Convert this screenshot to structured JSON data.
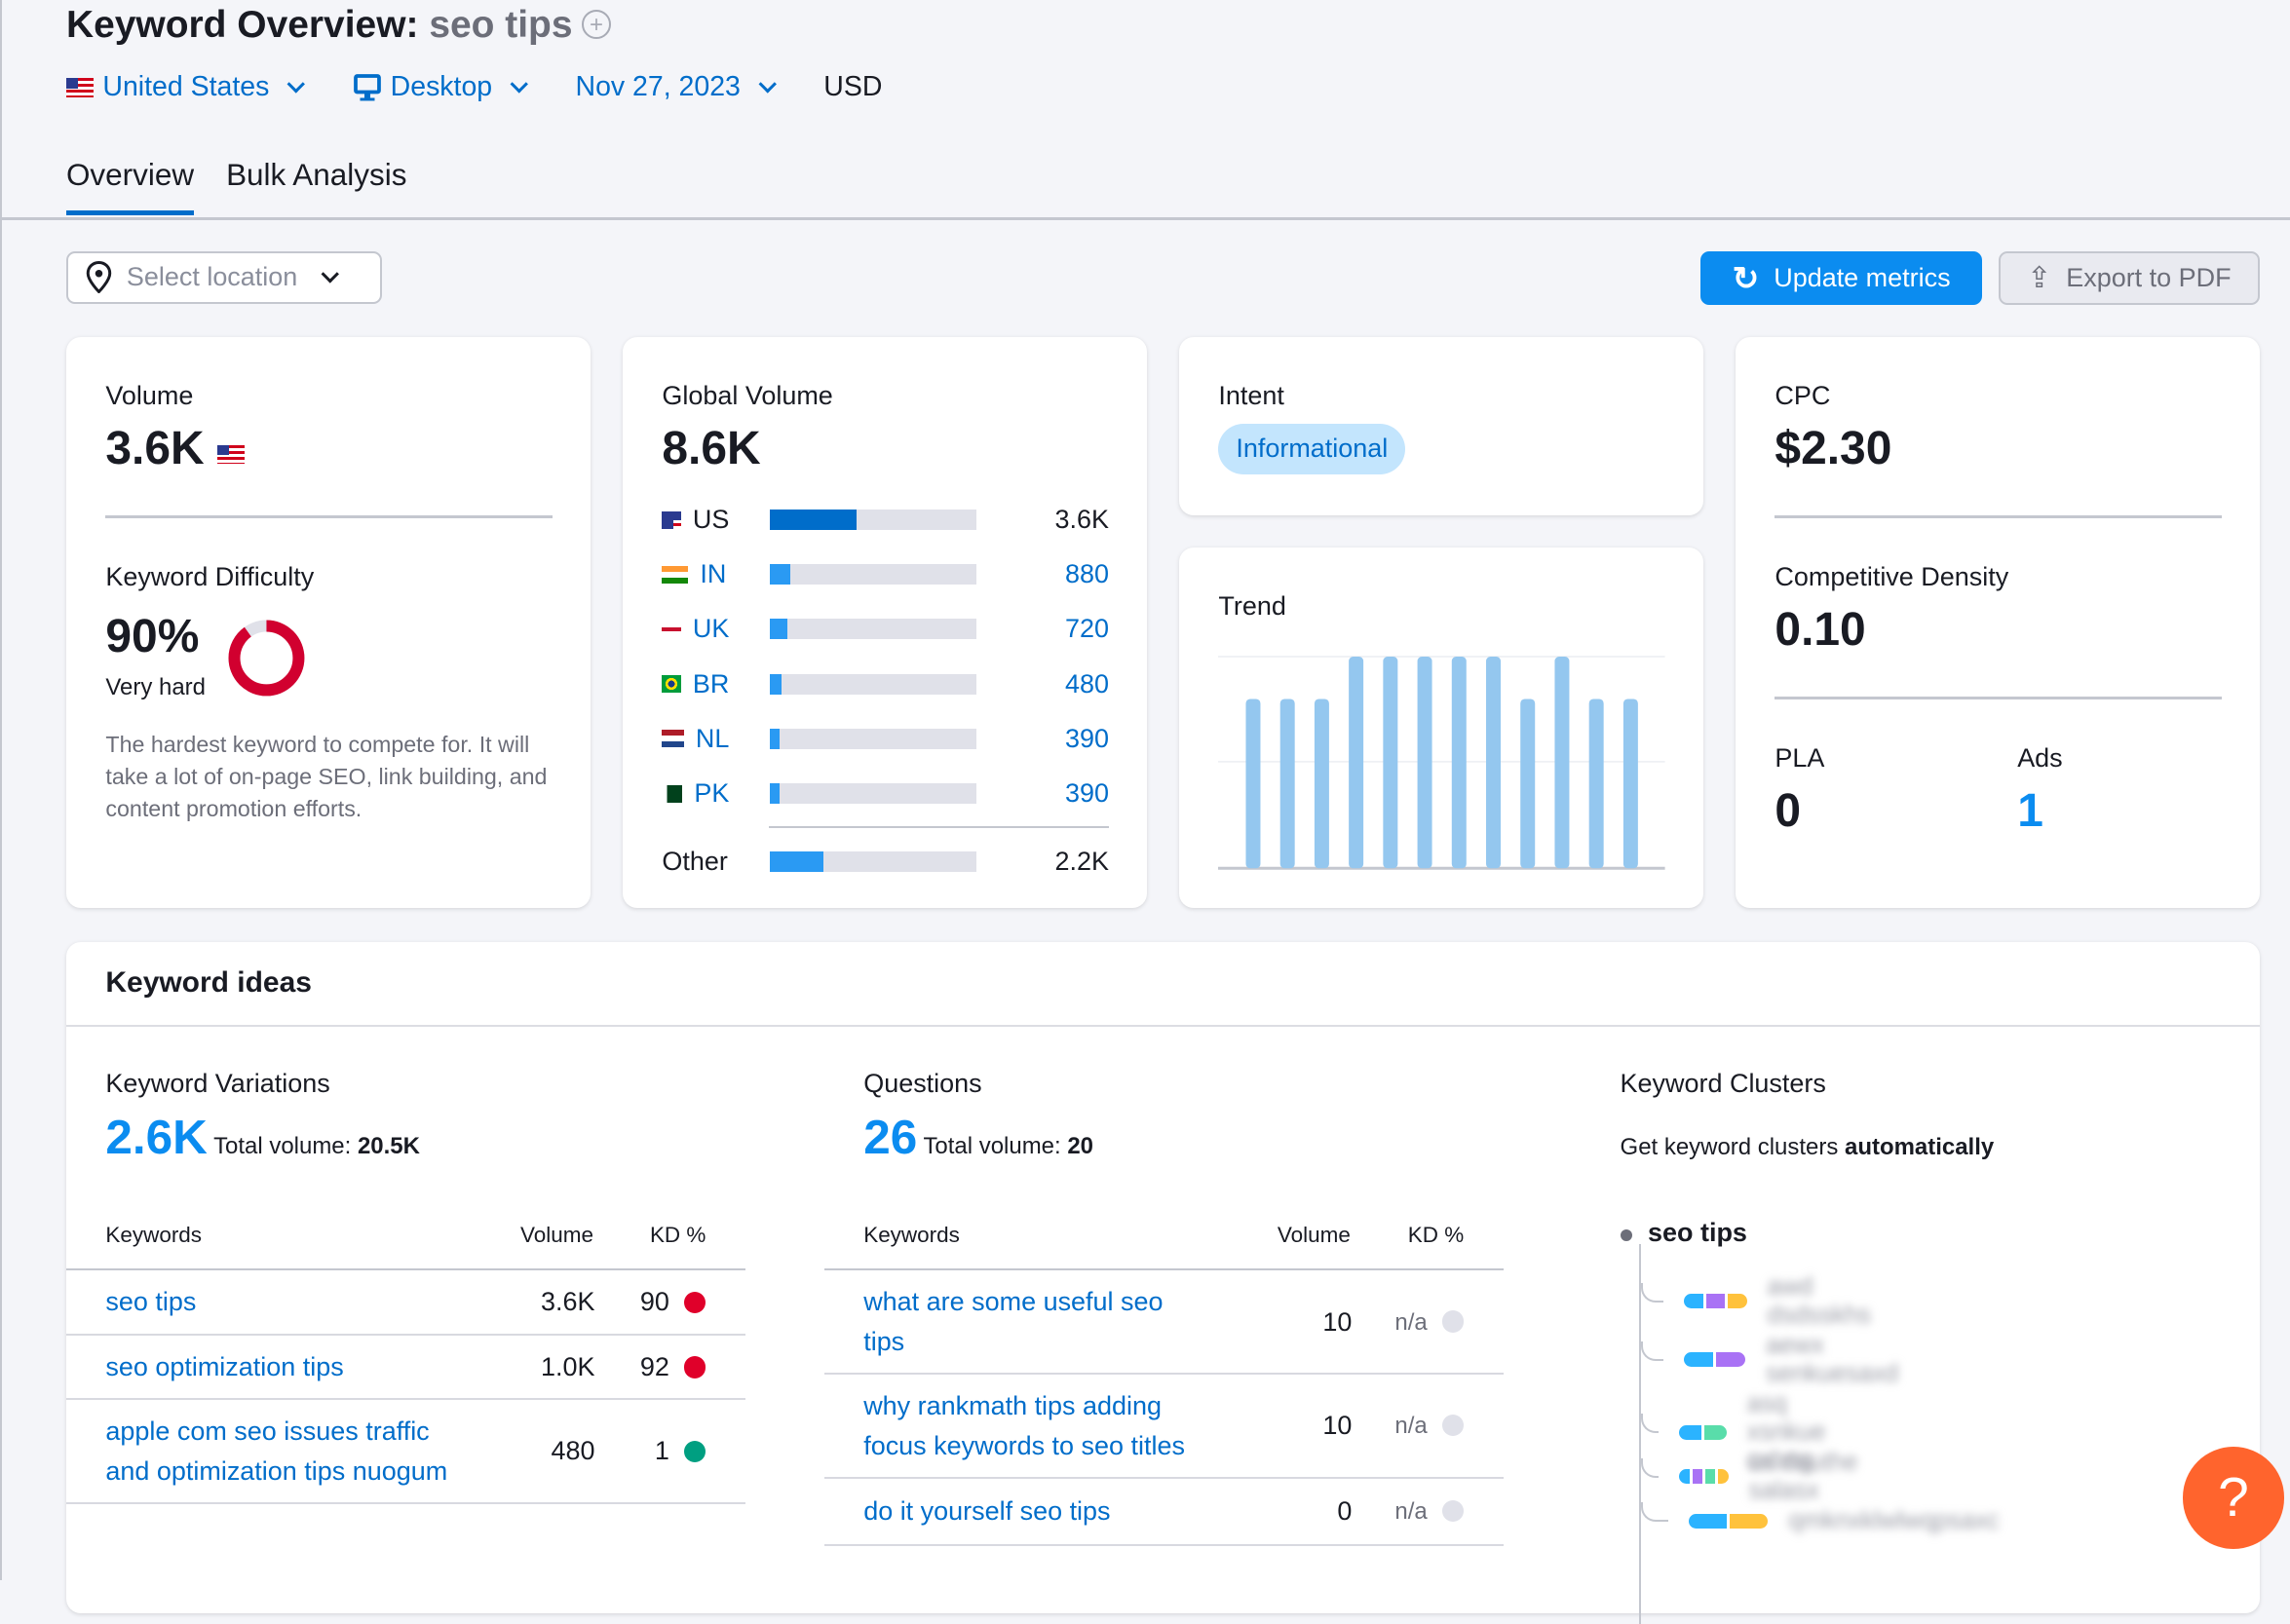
{
  "header": {
    "title": "Keyword Overview:",
    "keyword": "seo tips",
    "add_icon": "plus-circle-icon"
  },
  "filters": {
    "country": "United States",
    "device": "Desktop",
    "date": "Nov 27, 2023",
    "currency": "USD"
  },
  "tabs": [
    {
      "label": "Overview",
      "active": true
    },
    {
      "label": "Bulk Analysis",
      "active": false
    }
  ],
  "toolbar": {
    "location_placeholder": "Select location",
    "update_label": "Update metrics",
    "export_label": "Export to PDF"
  },
  "volume": {
    "label": "Volume",
    "value": "3.6K",
    "kd_label": "Keyword Difficulty",
    "kd_value": "90%",
    "kd_percent": 90,
    "kd_level": "Very hard",
    "kd_desc": "The hardest keyword to compete for. It will take a lot of on-page SEO, link building, and content promotion efforts."
  },
  "global_volume": {
    "label": "Global Volume",
    "value": "8.6K",
    "countries": [
      {
        "code": "US",
        "value": "3.6K",
        "share": 0.42
      },
      {
        "code": "IN",
        "value": "880",
        "share": 0.1
      },
      {
        "code": "UK",
        "value": "720",
        "share": 0.084
      },
      {
        "code": "BR",
        "value": "480",
        "share": 0.056
      },
      {
        "code": "NL",
        "value": "390",
        "share": 0.045
      },
      {
        "code": "PK",
        "value": "390",
        "share": 0.045
      }
    ],
    "other_label": "Other",
    "other_value": "2.2K",
    "other_share": 0.26
  },
  "intent": {
    "label": "Intent",
    "value": "Informational"
  },
  "trend": {
    "label": "Trend",
    "values": [
      0.8,
      0.8,
      0.8,
      1,
      1,
      1,
      1,
      1,
      0.8,
      1,
      0.8,
      0.8
    ]
  },
  "cpc": {
    "label": "CPC",
    "value": "$2.30",
    "cd_label": "Competitive Density",
    "cd_value": "0.10",
    "pla_label": "PLA",
    "pla_value": "0",
    "ads_label": "Ads",
    "ads_value": "1"
  },
  "ideas": {
    "title": "Keyword ideas",
    "variations": {
      "title": "Keyword Variations",
      "count": "2.6K",
      "total_label": "Total volume:",
      "total": "20.5K",
      "columns": [
        "Keywords",
        "Volume",
        "KD %"
      ],
      "rows": [
        {
          "keyword": "seo tips",
          "volume": "3.6K",
          "kd": "90",
          "color": "#e0002a"
        },
        {
          "keyword": "seo optimization tips",
          "volume": "1.0K",
          "kd": "92",
          "color": "#e0002a"
        },
        {
          "keyword": "apple com seo issues traffic and optimization tips nuogum",
          "volume": "480",
          "kd": "1",
          "color": "#009f81"
        }
      ]
    },
    "questions": {
      "title": "Questions",
      "count": "26",
      "total_label": "Total volume:",
      "total": "20",
      "columns": [
        "Keywords",
        "Volume",
        "KD %"
      ],
      "rows": [
        {
          "keyword": "what are some useful seo tips",
          "volume": "10",
          "kd": "n/a",
          "color": "#e0e1e9"
        },
        {
          "keyword": "why rankmath tips adding focus keywords to seo titles",
          "volume": "10",
          "kd": "n/a",
          "color": "#e0e1e9"
        },
        {
          "keyword": "do it yourself seo tips",
          "volume": "0",
          "kd": "n/a",
          "color": "#e0e1e9"
        }
      ]
    },
    "clusters": {
      "title": "Keyword Clusters",
      "desc": "Get keyword clusters",
      "desc_bold": "automatically",
      "root": "seo tips",
      "items": [
        {
          "text": "awd dsdsskhs",
          "colors": [
            "#2bb3ff",
            "#a972f5",
            "#ffc23c"
          ]
        },
        {
          "text": "aewx senkuesaxd",
          "colors": [
            "#2bb3ff",
            "#a972f5"
          ]
        },
        {
          "text": "asq xsnkue cxbng",
          "colors": [
            "#2bb3ff",
            "#59ddaa"
          ]
        },
        {
          "text": "as dauthe salasx",
          "colors": [
            "#2bb3ff",
            "#a972f5",
            "#59ddaa",
            "#ffc23c"
          ]
        },
        {
          "text": "qmknxklwlwqpsaxc",
          "colors": [
            "#2bb3ff",
            "#ffc23c"
          ]
        }
      ]
    }
  },
  "help": {
    "label": "?"
  }
}
